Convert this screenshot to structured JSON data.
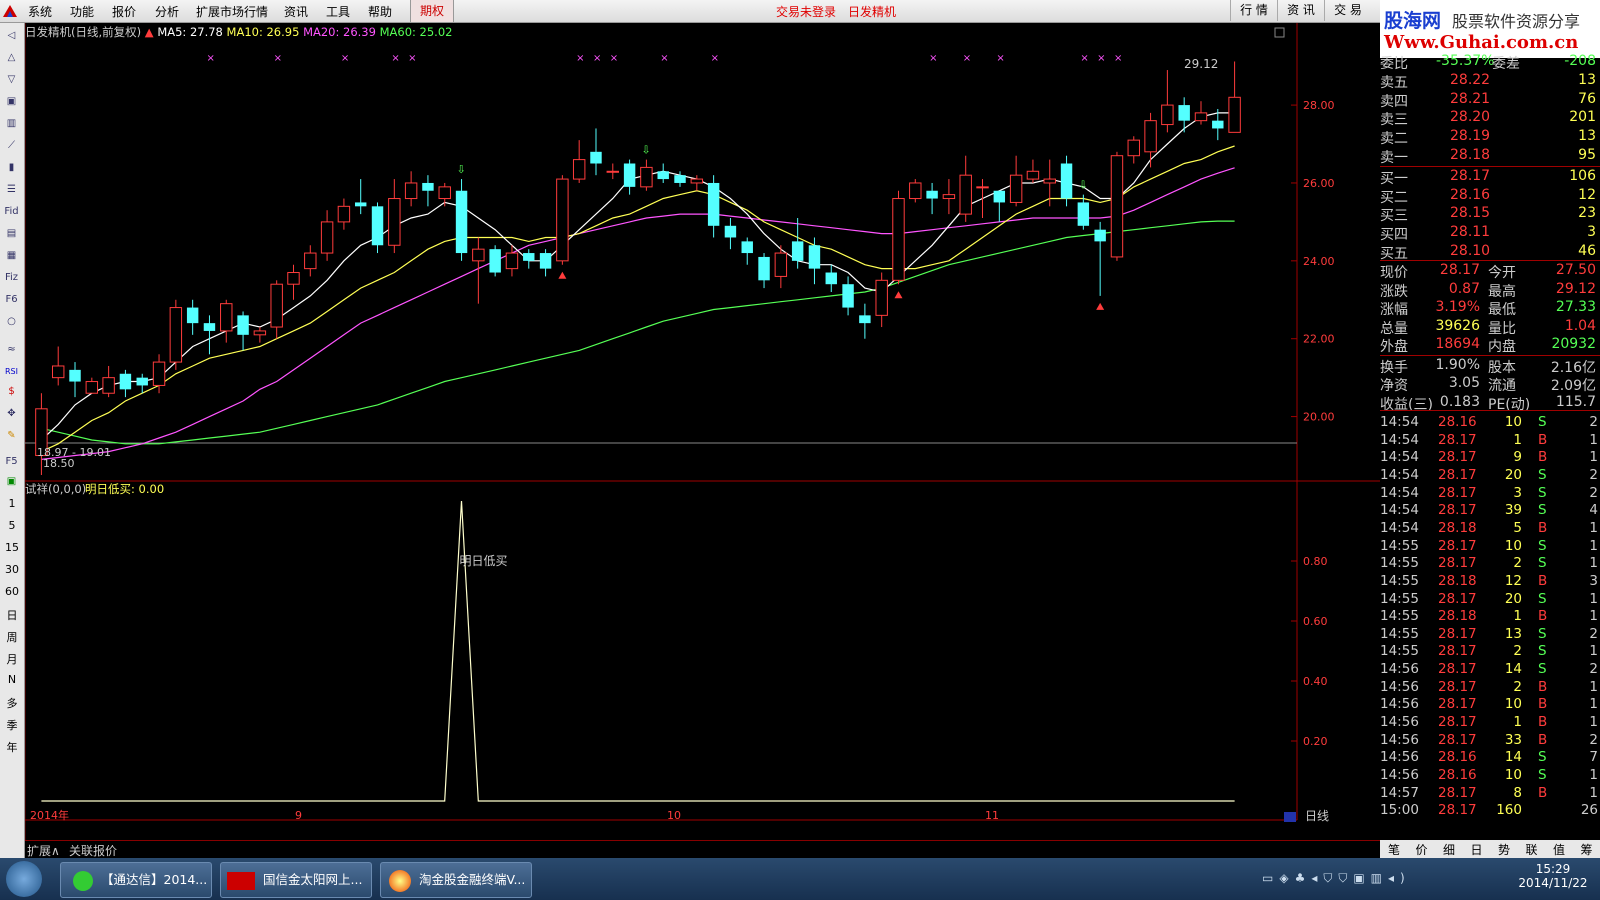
{
  "menubar": {
    "items": [
      "系统",
      "功能",
      "报价",
      "分析",
      "扩展市场行情",
      "资讯",
      "工具",
      "帮助"
    ],
    "options_tab": "期权",
    "status_left": "交易未登录",
    "status_right": "日发精机",
    "right_tabs": [
      "行 情",
      "资 讯",
      "交 易"
    ]
  },
  "banner": {
    "title": "股海网",
    "subtitle": "股票软件资源分享",
    "url": "Www.Guhai.com.cn"
  },
  "toolbar": {
    "labels": [
      "Fid",
      "Fiz",
      "F6",
      "RSI",
      "F5"
    ],
    "periods": [
      "1",
      "5",
      "15",
      "30",
      "60",
      "日",
      "周",
      "月",
      "N",
      "多",
      "季",
      "年"
    ]
  },
  "chart": {
    "title": "日发精机(日线,前复权)",
    "ma5": "MA5: 27.78",
    "ma10": "MA10: 26.95",
    "ma20": "MA20: 26.39",
    "ma60": "MA60: 25.02",
    "colors": {
      "up": "#ff3c3c",
      "down": "#54ffff",
      "ma5": "#ffffff",
      "ma10": "#ffff55",
      "ma20": "#ff55ff",
      "ma60": "#55ff55"
    },
    "high_label": "29.12",
    "low_label1": "18.97 - 19.01",
    "low_label2": "18.50",
    "y_ticks": [
      "28.00",
      "26.00",
      "24.00",
      "22.00",
      "20.00"
    ],
    "indicator_title": "试祥(0,0,0)",
    "indicator_value": "明日低买: 0.00",
    "indicator_peak_label": "明日低买",
    "ind_y_ticks": [
      "0.80",
      "0.60",
      "0.40",
      "0.20"
    ],
    "x_labels": [
      "2014年",
      "9",
      "10",
      "11"
    ],
    "period_label": "日线"
  },
  "chart_data": {
    "type": "candlestick",
    "y_range": [
      18.5,
      29.8
    ],
    "candles": [
      [
        19.0,
        20.2,
        18.5,
        20.6
      ],
      [
        21.0,
        21.3,
        20.8,
        21.8
      ],
      [
        21.2,
        20.9,
        20.5,
        21.4
      ],
      [
        20.6,
        20.9,
        20.6,
        21.0
      ],
      [
        20.6,
        21.0,
        20.5,
        21.3
      ],
      [
        21.1,
        20.7,
        20.5,
        21.2
      ],
      [
        21.0,
        20.8,
        20.6,
        21.1
      ],
      [
        20.8,
        21.4,
        20.6,
        21.6
      ],
      [
        21.4,
        22.8,
        21.2,
        23.0
      ],
      [
        22.8,
        22.4,
        22.1,
        23.0
      ],
      [
        22.4,
        22.2,
        21.6,
        22.6
      ],
      [
        22.2,
        22.9,
        21.9,
        23.0
      ],
      [
        22.6,
        22.1,
        21.7,
        22.7
      ],
      [
        22.1,
        22.2,
        21.9,
        22.3
      ],
      [
        22.3,
        23.4,
        22.0,
        23.5
      ],
      [
        23.4,
        23.7,
        23.0,
        23.9
      ],
      [
        23.8,
        24.2,
        23.6,
        24.4
      ],
      [
        24.2,
        25.0,
        24.0,
        25.3
      ],
      [
        25.0,
        25.4,
        24.8,
        25.6
      ],
      [
        25.5,
        25.4,
        25.2,
        26.1
      ],
      [
        25.4,
        24.4,
        24.2,
        25.5
      ],
      [
        24.4,
        25.6,
        24.2,
        26.1
      ],
      [
        25.6,
        26.0,
        25.4,
        26.3
      ],
      [
        26.0,
        25.8,
        25.4,
        26.2
      ],
      [
        25.6,
        25.9,
        25.4,
        26.0
      ],
      [
        25.8,
        24.2,
        24.0,
        26.1
      ],
      [
        24.0,
        24.3,
        22.9,
        24.6
      ],
      [
        24.3,
        23.7,
        23.6,
        24.4
      ],
      [
        23.8,
        24.2,
        23.6,
        24.4
      ],
      [
        24.2,
        24.0,
        23.8,
        24.3
      ],
      [
        24.2,
        23.8,
        23.6,
        24.3
      ],
      [
        24.0,
        26.1,
        23.9,
        26.2
      ],
      [
        26.1,
        26.6,
        26.0,
        27.1
      ],
      [
        26.8,
        26.5,
        26.2,
        27.4
      ],
      [
        26.3,
        26.3,
        26.1,
        26.5
      ],
      [
        26.5,
        25.9,
        25.7,
        26.6
      ],
      [
        25.9,
        26.4,
        25.8,
        26.6
      ],
      [
        26.3,
        26.1,
        26.0,
        26.5
      ],
      [
        26.2,
        26.0,
        25.9,
        26.3
      ],
      [
        26.0,
        26.1,
        25.8,
        26.2
      ],
      [
        26.0,
        24.9,
        24.6,
        26.2
      ],
      [
        24.9,
        24.6,
        24.3,
        25.1
      ],
      [
        24.5,
        24.2,
        23.9,
        24.6
      ],
      [
        24.1,
        23.5,
        23.3,
        24.2
      ],
      [
        23.6,
        24.2,
        23.3,
        24.4
      ],
      [
        24.5,
        24.0,
        23.8,
        25.1
      ],
      [
        24.4,
        23.8,
        23.4,
        24.6
      ],
      [
        23.7,
        23.4,
        23.2,
        23.9
      ],
      [
        23.4,
        22.8,
        22.6,
        23.6
      ],
      [
        22.6,
        22.4,
        22.0,
        22.9
      ],
      [
        22.6,
        23.5,
        22.3,
        23.7
      ],
      [
        23.5,
        25.6,
        23.4,
        25.8
      ],
      [
        25.6,
        26.0,
        25.5,
        26.1
      ],
      [
        25.8,
        25.6,
        25.2,
        26.0
      ],
      [
        25.6,
        25.7,
        25.2,
        26.1
      ],
      [
        25.2,
        26.2,
        25.0,
        26.7
      ],
      [
        25.9,
        25.9,
        25.1,
        26.1
      ],
      [
        25.8,
        25.5,
        25.0,
        25.8
      ],
      [
        25.5,
        26.2,
        25.4,
        26.7
      ],
      [
        26.1,
        26.3,
        26.0,
        26.6
      ],
      [
        26.0,
        26.1,
        25.4,
        26.6
      ],
      [
        26.5,
        25.6,
        25.4,
        26.7
      ],
      [
        25.5,
        24.9,
        24.8,
        25.7
      ],
      [
        24.8,
        24.5,
        23.1,
        25.0
      ],
      [
        24.1,
        26.7,
        24.0,
        26.8
      ],
      [
        26.7,
        27.1,
        26.5,
        27.2
      ],
      [
        26.8,
        27.6,
        26.4,
        27.8
      ],
      [
        27.5,
        28.0,
        27.3,
        28.9
      ],
      [
        28.0,
        27.6,
        27.3,
        28.2
      ],
      [
        27.6,
        27.8,
        27.5,
        28.1
      ],
      [
        27.6,
        27.4,
        27.1,
        27.9
      ],
      [
        27.3,
        28.2,
        27.3,
        29.12
      ]
    ],
    "ma5": [
      19.4,
      19.8,
      20.3,
      20.6,
      20.8,
      20.9,
      20.9,
      21.0,
      21.4,
      21.8,
      22.0,
      22.2,
      22.4,
      22.3,
      22.5,
      22.8,
      23.1,
      23.5,
      24.0,
      24.4,
      24.6,
      24.9,
      25.1,
      25.2,
      25.5,
      25.4,
      25.1,
      24.8,
      24.4,
      24.0,
      24.0,
      24.4,
      24.8,
      25.2,
      25.6,
      26.1,
      26.2,
      26.3,
      26.2,
      26.1,
      25.9,
      25.6,
      25.2,
      24.7,
      24.3,
      24.0,
      23.9,
      23.9,
      23.7,
      23.3,
      23.2,
      23.6,
      24.0,
      24.4,
      24.9,
      25.4,
      25.6,
      25.8,
      26.0,
      26.0,
      26.1,
      26.0,
      25.9,
      25.6,
      25.6,
      26.0,
      26.6,
      27.0,
      27.4,
      27.7,
      27.8,
      27.8
    ],
    "ma10": [
      19.1,
      19.3,
      19.6,
      19.9,
      20.1,
      20.4,
      20.6,
      20.8,
      21.1,
      21.3,
      21.5,
      21.6,
      21.7,
      21.8,
      22.0,
      22.2,
      22.4,
      22.7,
      23.0,
      23.3,
      23.5,
      23.7,
      24.0,
      24.3,
      24.5,
      24.6,
      24.6,
      24.6,
      24.6,
      24.5,
      24.6,
      24.6,
      24.7,
      24.9,
      25.1,
      25.2,
      25.4,
      25.6,
      25.7,
      25.8,
      25.7,
      25.5,
      25.3,
      25.0,
      24.8,
      24.6,
      24.4,
      24.3,
      24.1,
      23.9,
      23.8,
      23.8,
      23.8,
      23.9,
      24.0,
      24.3,
      24.6,
      24.9,
      25.2,
      25.4,
      25.6,
      25.6,
      25.6,
      25.5,
      25.6,
      25.9,
      26.1,
      26.3,
      26.5,
      26.6,
      26.8,
      26.95
    ],
    "ma20": [
      18.9,
      18.95,
      19.0,
      19.05,
      19.1,
      19.2,
      19.3,
      19.45,
      19.6,
      19.8,
      20.0,
      20.2,
      20.4,
      20.7,
      20.9,
      21.2,
      21.5,
      21.8,
      22.1,
      22.4,
      22.6,
      22.8,
      23.0,
      23.2,
      23.4,
      23.6,
      23.8,
      24.0,
      24.2,
      24.4,
      24.5,
      24.6,
      24.7,
      24.8,
      24.9,
      25.0,
      25.1,
      25.15,
      25.2,
      25.2,
      25.2,
      25.15,
      25.1,
      25.05,
      25.0,
      24.95,
      24.9,
      24.85,
      24.8,
      24.75,
      24.7,
      24.7,
      24.75,
      24.8,
      24.85,
      24.9,
      24.95,
      25.0,
      25.05,
      25.1,
      25.1,
      25.1,
      25.1,
      25.1,
      25.15,
      25.3,
      25.5,
      25.7,
      25.9,
      26.1,
      26.25,
      26.39
    ],
    "ma60": [
      19.7,
      19.6,
      19.5,
      19.4,
      19.35,
      19.3,
      19.3,
      19.3,
      19.35,
      19.4,
      19.45,
      19.5,
      19.55,
      19.6,
      19.7,
      19.8,
      19.9,
      20.0,
      20.1,
      20.2,
      20.3,
      20.45,
      20.6,
      20.75,
      20.9,
      21.0,
      21.1,
      21.2,
      21.3,
      21.4,
      21.5,
      21.6,
      21.7,
      21.85,
      22.0,
      22.15,
      22.3,
      22.45,
      22.55,
      22.65,
      22.75,
      22.8,
      22.85,
      22.9,
      22.95,
      23.0,
      23.05,
      23.1,
      23.15,
      23.2,
      23.3,
      23.45,
      23.6,
      23.75,
      23.9,
      24.0,
      24.1,
      24.2,
      24.3,
      24.4,
      24.5,
      24.6,
      24.65,
      24.7,
      24.75,
      24.8,
      24.85,
      24.9,
      24.95,
      25.0,
      25.02,
      25.02
    ],
    "indicator_peak_index": 25,
    "indicator_range": [
      0,
      1
    ]
  },
  "quotes": {
    "wei_bi_label": "委比",
    "wei_bi": "-35.37%",
    "wei_cha_label": "委差",
    "wei_cha": "-208",
    "sell": [
      {
        "label": "卖五",
        "price": "28.22",
        "vol": "13"
      },
      {
        "label": "卖四",
        "price": "28.21",
        "vol": "76"
      },
      {
        "label": "卖三",
        "price": "28.20",
        "vol": "201"
      },
      {
        "label": "卖二",
        "price": "28.19",
        "vol": "13"
      },
      {
        "label": "卖一",
        "price": "28.18",
        "vol": "95"
      }
    ],
    "buy": [
      {
        "label": "买一",
        "price": "28.17",
        "vol": "106"
      },
      {
        "label": "买二",
        "price": "28.16",
        "vol": "12"
      },
      {
        "label": "买三",
        "price": "28.15",
        "vol": "23"
      },
      {
        "label": "买四",
        "price": "28.11",
        "vol": "3"
      },
      {
        "label": "买五",
        "price": "28.10",
        "vol": "46"
      }
    ],
    "stats": [
      {
        "l1": "现价",
        "v1": "28.17",
        "l2": "今开",
        "v2": "27.50"
      },
      {
        "l1": "涨跌",
        "v1": "0.87",
        "l2": "最高",
        "v2": "29.12"
      },
      {
        "l1": "涨幅",
        "v1": "3.19%",
        "l2": "最低",
        "v2": "27.33"
      },
      {
        "l1": "总量",
        "v1": "39626",
        "l2": "量比",
        "v2": "1.04"
      },
      {
        "l1": "外盘",
        "v1": "18694",
        "l2": "内盘",
        "v2": "20932"
      },
      {
        "l1": "换手",
        "v1": "1.90%",
        "l2": "股本",
        "v2": "2.16亿"
      },
      {
        "l1": "净资",
        "v1": "3.05",
        "l2": "流通",
        "v2": "2.09亿"
      },
      {
        "l1": "收益(三)",
        "v1": "0.183",
        "l2": "PE(动)",
        "v2": "115.7"
      }
    ]
  },
  "ticks": [
    [
      "14:54",
      "28.16",
      "10",
      "S",
      "2"
    ],
    [
      "14:54",
      "28.17",
      "1",
      "B",
      "1"
    ],
    [
      "14:54",
      "28.17",
      "9",
      "B",
      "1"
    ],
    [
      "14:54",
      "28.17",
      "20",
      "S",
      "2"
    ],
    [
      "14:54",
      "28.17",
      "3",
      "S",
      "2"
    ],
    [
      "14:54",
      "28.17",
      "39",
      "S",
      "4"
    ],
    [
      "14:54",
      "28.18",
      "5",
      "B",
      "1"
    ],
    [
      "14:55",
      "28.17",
      "10",
      "S",
      "1"
    ],
    [
      "14:55",
      "28.17",
      "2",
      "S",
      "1"
    ],
    [
      "14:55",
      "28.18",
      "12",
      "B",
      "3"
    ],
    [
      "14:55",
      "28.17",
      "20",
      "S",
      "1"
    ],
    [
      "14:55",
      "28.18",
      "1",
      "B",
      "1"
    ],
    [
      "14:55",
      "28.17",
      "13",
      "S",
      "2"
    ],
    [
      "14:55",
      "28.17",
      "2",
      "S",
      "1"
    ],
    [
      "14:56",
      "28.17",
      "14",
      "S",
      "2"
    ],
    [
      "14:56",
      "28.17",
      "2",
      "B",
      "1"
    ],
    [
      "14:56",
      "28.17",
      "10",
      "B",
      "1"
    ],
    [
      "14:56",
      "28.17",
      "1",
      "B",
      "1"
    ],
    [
      "14:56",
      "28.17",
      "33",
      "B",
      "2"
    ],
    [
      "14:56",
      "28.16",
      "14",
      "S",
      "7"
    ],
    [
      "14:56",
      "28.16",
      "10",
      "S",
      "1"
    ],
    [
      "14:57",
      "28.17",
      "8",
      "B",
      "1"
    ],
    [
      "15:00",
      "28.17",
      "160",
      "",
      "26"
    ]
  ],
  "bottom": {
    "tab1": "扩展∧",
    "tab2": "关联报价"
  },
  "side_tabs": [
    "笔",
    "价",
    "细",
    "日",
    "势",
    "联",
    "值",
    "筹"
  ],
  "taskbar": {
    "buttons": [
      "【通达信】2014...",
      "国信金太阳网上...",
      "淘金股金融终端V..."
    ],
    "time": "15:29",
    "date": "2014/11/22"
  }
}
